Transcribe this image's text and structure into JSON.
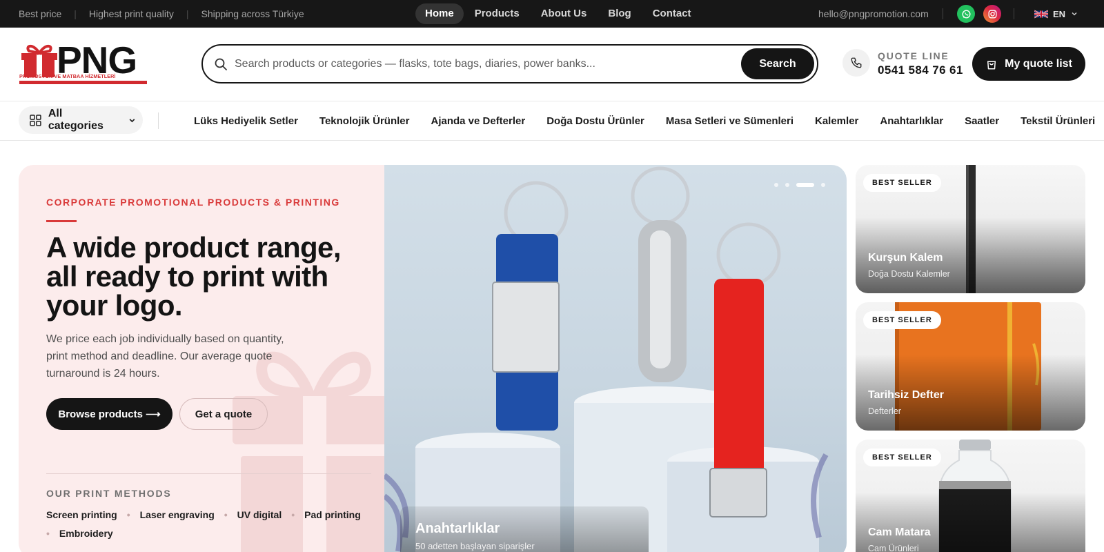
{
  "topbar": {
    "highlights": [
      "Best price",
      "Highest print quality",
      "Shipping across Türkiye"
    ],
    "nav": [
      {
        "label": "Home",
        "active": true
      },
      {
        "label": "Products",
        "active": false
      },
      {
        "label": "About Us",
        "active": false
      },
      {
        "label": "Blog",
        "active": false
      },
      {
        "label": "Contact",
        "active": false
      }
    ],
    "email": "hello@pngpromotion.com",
    "social_icons": [
      "whatsapp-icon",
      "instagram-icon"
    ],
    "language": "EN",
    "language_flag": "uk-flag-icon"
  },
  "header": {
    "logo": {
      "word": "PNG",
      "subtitle": "PROMOSYON VE MATBAA HİZMETLERİ",
      "brand_color": "#d12a2f"
    },
    "search": {
      "placeholder": "Search products or categories — flasks, tote bags, diaries, power banks...",
      "button_label": "Search"
    },
    "quote_line": {
      "label": "QUOTE LINE",
      "number": "0541 584 76 61"
    },
    "quote_list_label": "My quote list"
  },
  "category_nav": {
    "all_categories_label": "All categories",
    "links": [
      "Lüks Hediyelik Setler",
      "Teknolojik Ürünler",
      "Ajanda ve Defterler",
      "Doğa Dostu Ürünler",
      "Masa Setleri ve Sümenleri",
      "Kalemler",
      "Anahtarlıklar",
      "Saatler",
      "Tekstil Ürünleri"
    ]
  },
  "hero": {
    "eyebrow": "CORPORATE PROMOTIONAL PRODUCTS & PRINTING",
    "headline": "A wide product range, all ready to print with your logo.",
    "lede": "We price each job individually based on quantity, print method and deadline. Our average quote turnaround is 24 hours.",
    "primary_button": "Browse products ⟶",
    "secondary_button": "Get a quote",
    "methods_title": "OUR PRINT METHODS",
    "methods": [
      "Screen printing",
      "Laser engraving",
      "UV digital",
      "Pad printing",
      "Embroidery"
    ],
    "accent_color": "#d93a3a",
    "slider": {
      "slide_count": 4,
      "active_index": 2,
      "title": "Anahtarlıklar",
      "subtitle": "50 adetten başlayan siparişler"
    }
  },
  "side_cards": [
    {
      "badge": "BEST SELLER",
      "title": "Kurşun Kalem",
      "subtitle": "Doğa Dostu Kalemler"
    },
    {
      "badge": "BEST SELLER",
      "title": "Tarihsiz Defter",
      "subtitle": "Defterler"
    },
    {
      "badge": "BEST SELLER",
      "title": "Cam Matara",
      "subtitle": "Cam Ürünleri"
    }
  ]
}
